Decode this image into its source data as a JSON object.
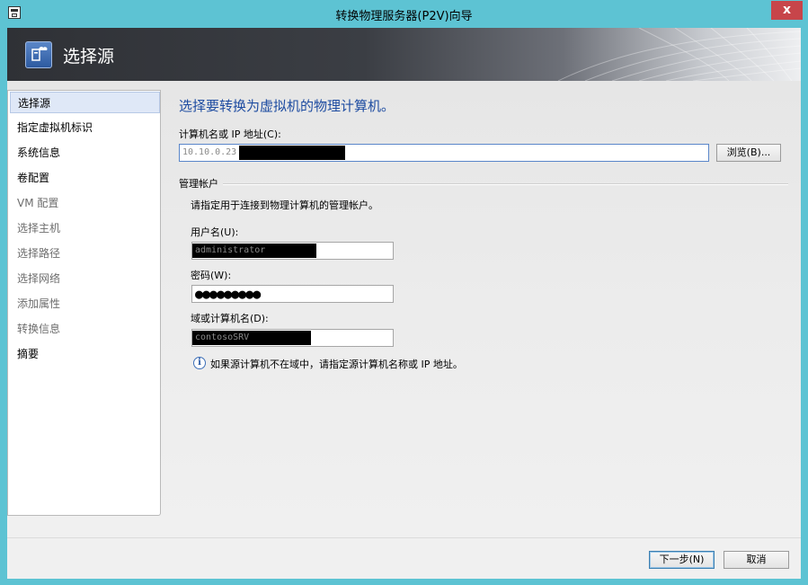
{
  "window": {
    "title": "转换物理服务器(P2V)向导",
    "close_glyph": "x"
  },
  "banner": {
    "title": "选择源",
    "icon": "p2v-wizard-icon"
  },
  "sidebar": {
    "items": [
      {
        "label": "选择源",
        "state": "active"
      },
      {
        "label": "指定虚拟机标识",
        "state": "enabled"
      },
      {
        "label": "系统信息",
        "state": "enabled"
      },
      {
        "label": "卷配置",
        "state": "enabled"
      },
      {
        "label": "VM 配置",
        "state": "disabled"
      },
      {
        "label": "选择主机",
        "state": "disabled"
      },
      {
        "label": "选择路径",
        "state": "disabled"
      },
      {
        "label": "选择网络",
        "state": "disabled"
      },
      {
        "label": "添加属性",
        "state": "disabled"
      },
      {
        "label": "转换信息",
        "state": "disabled"
      },
      {
        "label": "摘要",
        "state": "enabled"
      }
    ]
  },
  "main": {
    "heading": "选择要转换为虚拟机的物理计算机。",
    "computer_label": "计算机名或 IP 地址(C):",
    "computer_value": "10.10.0.23",
    "browse_label": "浏览(B)...",
    "group_title": "管理帐户",
    "group_desc": "请指定用于连接到物理计算机的管理帐户。",
    "username_label": "用户名(U):",
    "username_value": "administrator",
    "password_label": "密码(W):",
    "password_value": "●●●●●●●●●",
    "domain_label": "域或计算机名(D):",
    "domain_value": "contosoSRV",
    "info_text": "如果源计算机不在域中，请指定源计算机名称或 IP 地址。"
  },
  "footer": {
    "next_label": "下一步(N)",
    "cancel_label": "取消"
  },
  "colors": {
    "accent": "#1e4ca1",
    "frame": "#5dc3d3",
    "close": "#c7454a",
    "banner_dark": "#2f3136"
  }
}
